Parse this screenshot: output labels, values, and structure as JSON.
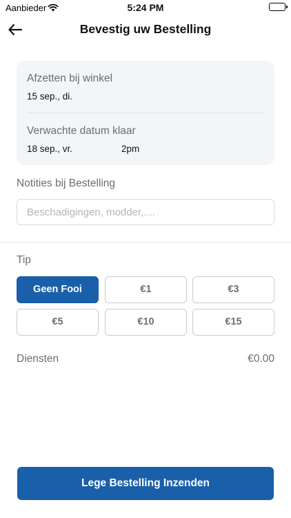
{
  "status_bar": {
    "carrier": "Aanbieder",
    "time": "5:24 PM"
  },
  "header": {
    "title": "Bevestig uw Bestelling"
  },
  "drop_off": {
    "label": "Afzetten bij winkel",
    "date": "15 sep., di."
  },
  "expected": {
    "label": "Verwachte datum klaar",
    "date": "18 sep., vr.",
    "time": "2pm"
  },
  "notes": {
    "label": "Notities bij Bestelling",
    "value": "",
    "placeholder": "Beschadigingen, modder,...."
  },
  "tip": {
    "label": "Tip",
    "options": [
      "Geen Fooi",
      "€1",
      "€3",
      "€5",
      "€10",
      "€15"
    ],
    "selected": "Geen Fooi"
  },
  "services": {
    "label": "Diensten",
    "amount": "€0.00"
  },
  "submit": {
    "label": "Lege Bestelling Inzenden"
  },
  "colors": {
    "accent": "#1a5fa9",
    "card_bg": "#f4f5f9",
    "muted_text": "#6b6d74"
  }
}
